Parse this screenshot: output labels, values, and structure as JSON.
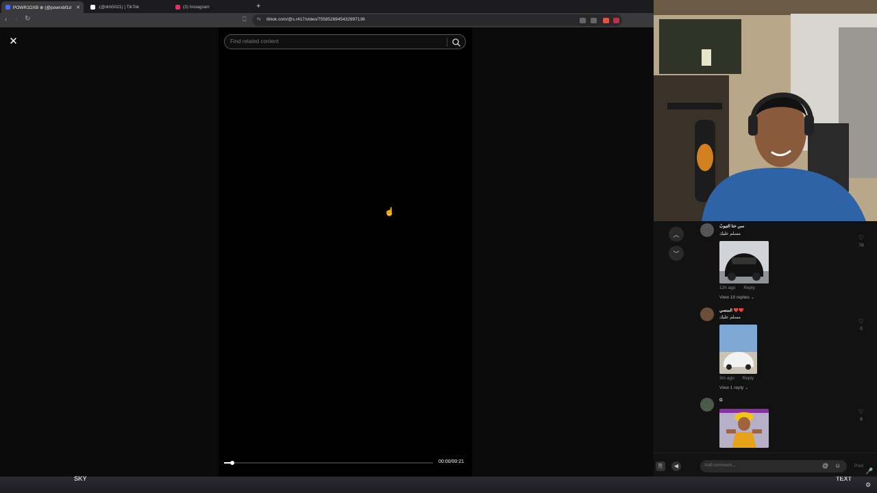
{
  "browser": {
    "tabs": [
      {
        "label": "POWR1DXB ⊕ (@powrxbf1d",
        "active": true,
        "color": "#4a6cf7"
      },
      {
        "label": ".(@drb5021) | TikTok",
        "active": false,
        "color": "#ffffff"
      },
      {
        "label": "(3) Instagram",
        "active": false,
        "color": "#e1306c"
      }
    ],
    "new_tab": "+",
    "url": "tiktok.com/@s.r417/video/7558526945432997136"
  },
  "player": {
    "close": "✕",
    "search_placeholder": "Find related content",
    "progress": 0.04,
    "time": "00:00/00:21"
  },
  "taskbar": {
    "left_text": "SKY",
    "right_text": "TEXT"
  },
  "comments": {
    "items": [
      {
        "user": "سن خنا التيوبُ",
        "text": "مسلم عليك",
        "time": "12h ago",
        "reply": "Reply",
        "replies": "View 18 replies",
        "likes": "78"
      },
      {
        "user": "المنصي ❤️❤️",
        "text": "مسلم عليك",
        "time": "3m ago",
        "reply": "Reply",
        "replies": "View 1 reply",
        "likes": "0"
      },
      {
        "user": "G",
        "text": "",
        "likes": "8"
      }
    ],
    "input_placeholder": "Add comment...",
    "post": "Post"
  }
}
